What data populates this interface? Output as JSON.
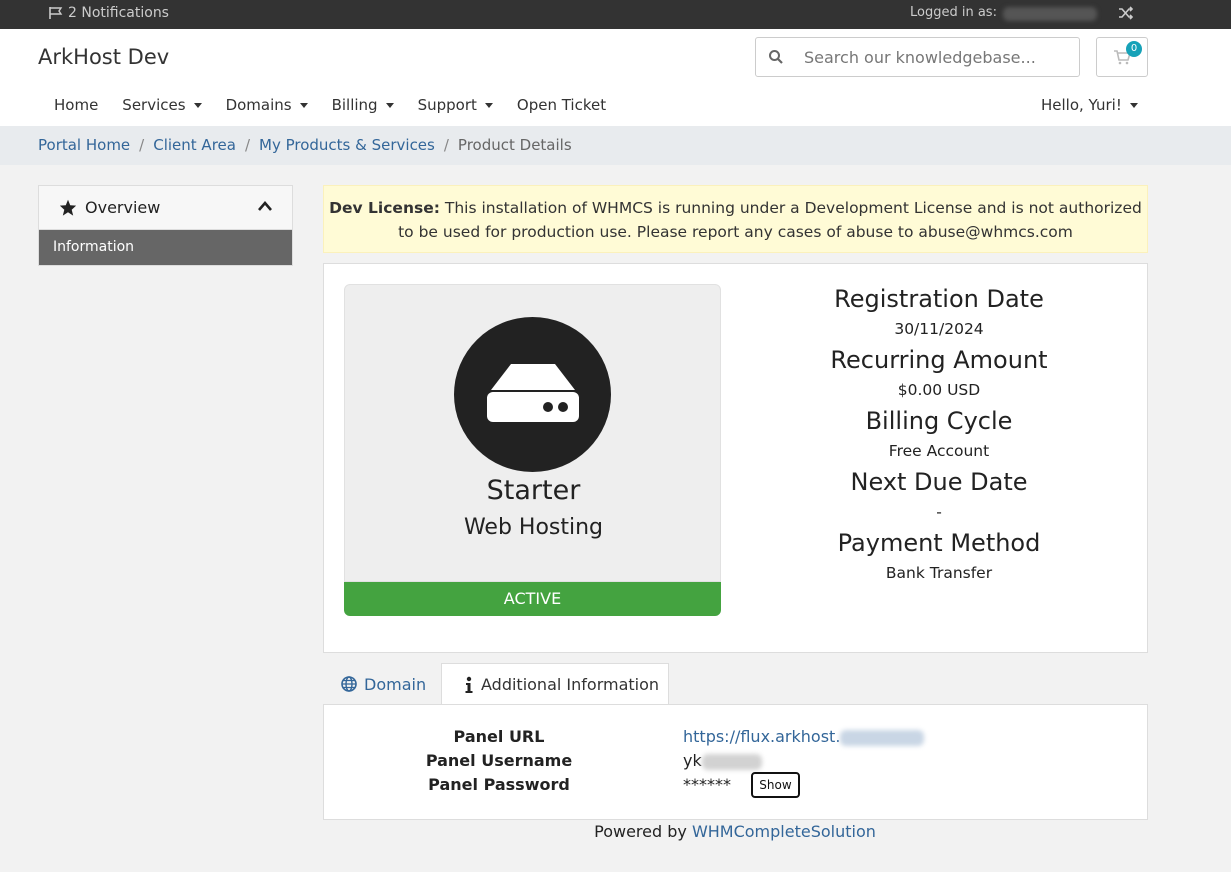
{
  "topbar": {
    "notifications": "2 Notifications",
    "logged_in_label": "Logged in as:",
    "icons": [
      "flag-icon",
      "shuffle-icon"
    ]
  },
  "header": {
    "brand": "ArkHost Dev",
    "search_placeholder": "Search our knowledgebase...",
    "cart_count": "0"
  },
  "nav": {
    "items": [
      {
        "label": "Home",
        "dropdown": false
      },
      {
        "label": "Services",
        "dropdown": true
      },
      {
        "label": "Domains",
        "dropdown": true
      },
      {
        "label": "Billing",
        "dropdown": true
      },
      {
        "label": "Support",
        "dropdown": true
      },
      {
        "label": "Open Ticket",
        "dropdown": false
      }
    ],
    "account": "Hello, Yuri!"
  },
  "breadcrumb": {
    "items": [
      "Portal Home",
      "Client Area",
      "My Products & Services"
    ],
    "active": "Product Details"
  },
  "sidebar": {
    "title": "Overview",
    "item": "Information"
  },
  "alert": {
    "strong": "Dev License:",
    "text": "This installation of WHMCS is running under a Development License and is not authorized to be used for production use. Please report any cases of abuse to abuse@whmcs.com"
  },
  "product": {
    "name": "Starter",
    "group": "Web Hosting",
    "status": "ACTIVE",
    "status_color": "#44a340"
  },
  "details": {
    "registration_label": "Registration Date",
    "registration_value": "30/11/2024",
    "recurring_label": "Recurring Amount",
    "recurring_value": "$0.00 USD",
    "cycle_label": "Billing Cycle",
    "cycle_value": "Free Account",
    "due_label": "Next Due Date",
    "due_value": "-",
    "payment_label": "Payment Method",
    "payment_value": "Bank Transfer"
  },
  "tabs": {
    "domain": "Domain",
    "additional": "Additional Information"
  },
  "additional": {
    "url_label": "Panel URL",
    "url_value": "https://flux.arkhost.",
    "username_label": "Panel Username",
    "username_value": "yk",
    "password_label": "Panel Password",
    "password_value": "******",
    "show_button": "Show"
  },
  "footer": {
    "prefix": "Powered by",
    "link": "WHMCompleteSolution"
  },
  "colors": {
    "topbar": "#333333",
    "link": "#336699",
    "alert_bg": "#fffbd6",
    "badge": "#17a2b8"
  }
}
